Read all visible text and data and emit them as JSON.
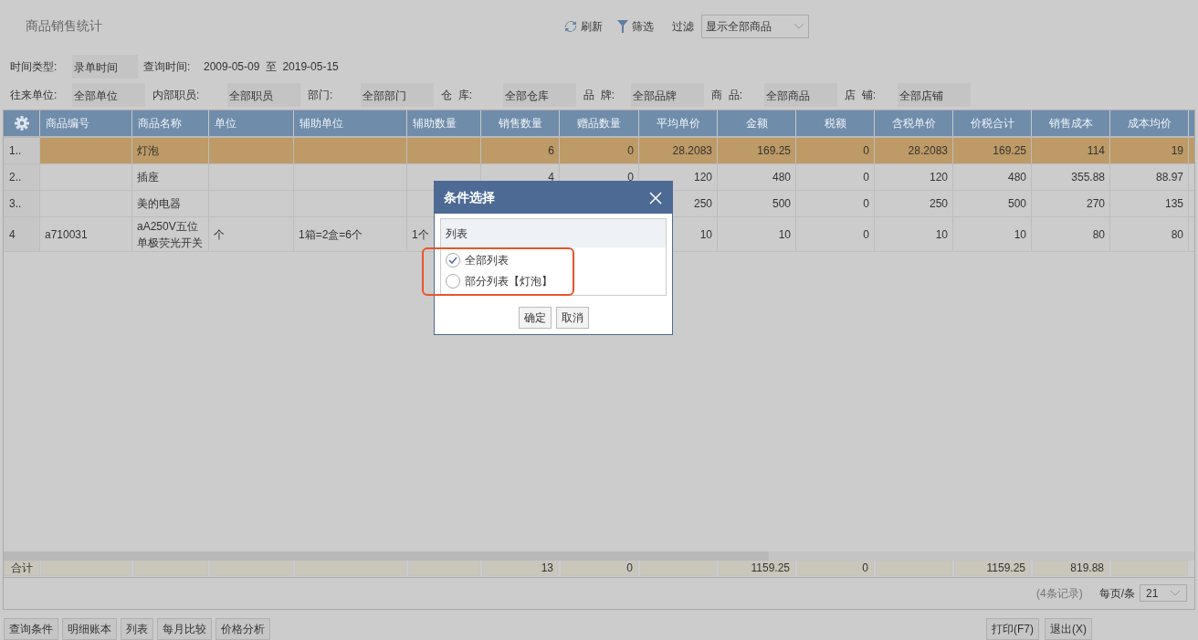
{
  "window": {
    "title": "商品销售统计"
  },
  "toolbar": {
    "refresh": "刷新",
    "filter": "筛选",
    "filter_label": "过滤",
    "filter_select": "显示全部商品"
  },
  "query_row": [
    {
      "label": "时间类型:",
      "value": "录单时间"
    }
  ],
  "query_time": {
    "label": "查询时间:",
    "from": "2009-05-09",
    "sep": "至",
    "to": "2019-05-15"
  },
  "filters": [
    {
      "label": "往来单位:",
      "value": "全部单位"
    },
    {
      "label": "内部职员:",
      "value": "全部职员"
    },
    {
      "label": "部门:",
      "value": "全部部门"
    },
    {
      "label": "仓  库:",
      "value": "全部仓库"
    },
    {
      "label": "品  牌:",
      "value": "全部品牌"
    },
    {
      "label": "商  品:",
      "value": "全部商品"
    },
    {
      "label": "店  铺:",
      "value": "全部店铺"
    }
  ],
  "table": {
    "columns": [
      "商品编号",
      "商品名称",
      "单位",
      "辅助单位",
      "辅助数量",
      "销售数量",
      "赠品数量",
      "平均单价",
      "金额",
      "税额",
      "含税单价",
      "价税合计",
      "销售成本",
      "成本均价"
    ],
    "rows": [
      {
        "index": "1..",
        "selected": true,
        "cells": [
          "",
          "灯泡",
          "",
          "",
          "",
          "6",
          "0",
          "28.2083",
          "169.25",
          "0",
          "28.2083",
          "169.25",
          "114",
          "19"
        ]
      },
      {
        "index": "2..",
        "selected": false,
        "cells": [
          "",
          "插座",
          "",
          "",
          "",
          "4",
          "0",
          "120",
          "480",
          "0",
          "120",
          "480",
          "355.88",
          "88.97"
        ]
      },
      {
        "index": "3..",
        "selected": false,
        "cells": [
          "",
          "美的电器",
          "",
          "",
          "",
          null,
          null,
          "250",
          "500",
          "0",
          "250",
          "500",
          "270",
          "135"
        ]
      },
      {
        "index": "4",
        "selected": false,
        "cells": [
          "a710031",
          "aA250V五位单极荧光开关",
          "个",
          "1箱=2盒=6个",
          "1个",
          null,
          null,
          "10",
          "10",
          "0",
          "10",
          "10",
          "80",
          "80"
        ]
      }
    ],
    "totals": {
      "label": "合计",
      "cells": [
        "",
        "",
        "",
        "",
        "",
        "13",
        "0",
        "",
        "1159.25",
        "0",
        "",
        "1159.25",
        "819.88",
        ""
      ]
    }
  },
  "pager": {
    "records": "(4条记录)",
    "per_page_label": "每页/条",
    "per_page": "21"
  },
  "bottom_buttons_left": [
    "查询条件",
    "明细账本",
    "列表",
    "每月比较",
    "价格分析"
  ],
  "bottom_buttons_right": [
    "打印(F7)",
    "退出(X)"
  ],
  "dialog": {
    "title": "条件选择",
    "group": "列表",
    "options": [
      {
        "label": "全部列表",
        "selected": true
      },
      {
        "label": "部分列表【灯泡】",
        "selected": false
      }
    ],
    "buttons": [
      "确定",
      "取消"
    ]
  }
}
